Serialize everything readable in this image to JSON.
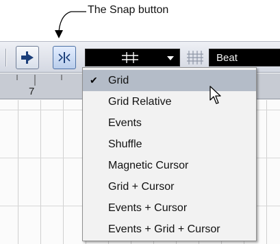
{
  "callout": {
    "text": "The Snap button"
  },
  "toolbar": {
    "stepper_icon": "insert-arrow-icon",
    "snap_icon": "snap-arrows-icon",
    "grid_type_icon": "grid-icon",
    "quantize_icon": "quantize-grid-icon",
    "quantize_value": "Beat"
  },
  "ruler": {
    "label": "7"
  },
  "snap_menu": {
    "selected": "Grid",
    "items": [
      {
        "label": "Grid",
        "checked": true
      },
      {
        "label": "Grid Relative",
        "checked": false
      },
      {
        "label": "Events",
        "checked": false
      },
      {
        "label": "Shuffle",
        "checked": false
      },
      {
        "label": "Magnetic Cursor",
        "checked": false
      },
      {
        "label": "Grid + Cursor",
        "checked": false
      },
      {
        "label": "Events + Cursor",
        "checked": false
      },
      {
        "label": "Events + Grid + Cursor",
        "checked": false
      }
    ],
    "check_glyph": "✔"
  },
  "colors": {
    "toolbar_bg": "#d4d8e2",
    "menu_bg": "#f2f2f2",
    "menu_highlight": "#b4bcc8",
    "display_bg": "#000000"
  }
}
